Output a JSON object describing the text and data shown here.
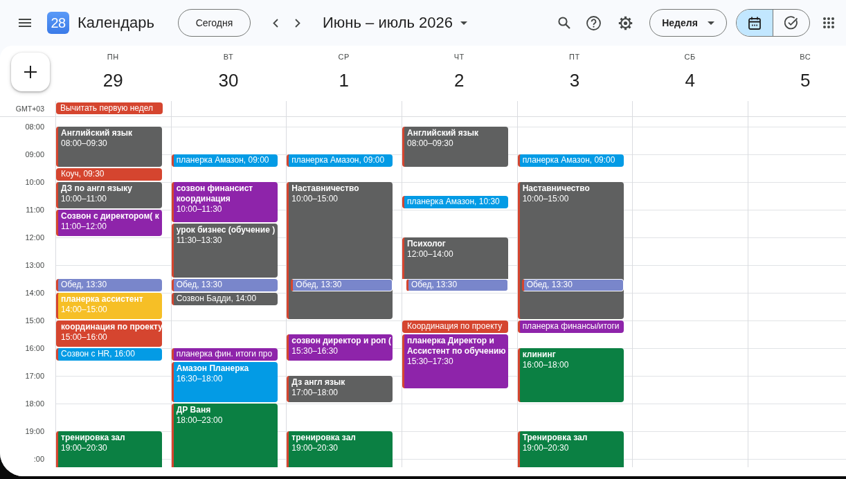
{
  "header": {
    "app_name": "Календарь",
    "logo_day": "28",
    "today_button": "Сегодня",
    "period_title": "Июнь – июль 2026",
    "view_button": "Неделя",
    "mode_toggle": [
      {
        "kind": "calendar",
        "selected": true
      },
      {
        "kind": "tasks",
        "selected": false
      }
    ]
  },
  "timezone": "GMT+03",
  "days": [
    {
      "weekday": "ПН",
      "date": "29",
      "all_day": [
        {
          "title": "Вычитать первую недел",
          "color": "#d5452f"
        }
      ]
    },
    {
      "weekday": "ВТ",
      "date": "30"
    },
    {
      "weekday": "СР",
      "date": "1"
    },
    {
      "weekday": "ЧТ",
      "date": "2"
    },
    {
      "weekday": "ПТ",
      "date": "3"
    },
    {
      "weekday": "СБ",
      "date": "4"
    },
    {
      "weekday": "ВС",
      "date": "5"
    }
  ],
  "rows": [
    {
      "label": "08:00",
      "cells": [
        {
          "events": [
            {
              "title": "Английский язык",
              "time": "08:00–09:30",
              "color": "#5f6060"
            }
          ]
        },
        {},
        {},
        {
          "events": [
            {
              "title": "Английский язык",
              "time": "08:00–09:30",
              "color": "#5f6060"
            }
          ]
        }
      ]
    },
    {
      "label": "09:00",
      "cells": [
        {
          "events": [
            {
              "title": "Коуч, 09:30",
              "color": "#d5452f"
            }
          ]
        },
        {
          "events": [
            {
              "title": "планерка Амазон, 09:00",
              "color": "#039be5"
            }
          ]
        },
        {
          "events": [
            {
              "title": "планерка Амазон, 09:00",
              "color": "#039be5"
            }
          ]
        },
        {},
        {
          "events": [
            {
              "title": "планерка Амазон, 09:00",
              "color": "#039be5"
            }
          ]
        }
      ]
    },
    {
      "label": "10:00",
      "cells": [
        {
          "events": [
            {
              "title": "ДЗ по англ языку",
              "time": "10:00–11:00",
              "color": "#5f6060"
            }
          ]
        },
        {
          "events": [
            {
              "title": "созвон финансист координация",
              "time": "10:00–11:30",
              "color": "#8e24aa"
            }
          ]
        },
        {
          "events": [
            {
              "title": "Наставничество",
              "time": "10:00–15:00",
              "color": "#5f6060"
            }
          ]
        },
        {
          "events": [
            {
              "title": "планерка Амазон, 10:30",
              "color": "#039be5"
            }
          ]
        },
        {
          "events": [
            {
              "title": "Наставничество",
              "time": "10:00–15:00",
              "color": "#5f6060"
            }
          ]
        }
      ]
    },
    {
      "label": "11:00",
      "cells": [
        {
          "events": [
            {
              "title": "Созвон с директором( к",
              "time": "11:00–12:00",
              "color": "#8e24aa"
            }
          ]
        },
        {
          "events": [
            {
              "title": "урок бизнес (обучение )",
              "time": "11:30–13:30",
              "color": "#5f6060"
            }
          ]
        }
      ]
    },
    {
      "label": "12:00",
      "cells": [
        {},
        {},
        {},
        {
          "events": [
            {
              "title": "Психолог",
              "time": "12:00–14:00",
              "color": "#5f6060"
            }
          ]
        }
      ]
    },
    {
      "label": "13:00",
      "cells": [
        {
          "events": [
            {
              "title": "Обед, 13:30",
              "color": "#7986cb"
            }
          ]
        },
        {
          "events": [
            {
              "title": "Обед, 13:30",
              "color": "#7986cb"
            }
          ]
        },
        {
          "events": [
            {
              "title": "Обед, 13:30",
              "color": "#7986cb"
            }
          ]
        },
        {
          "events": [
            {
              "title": "Обед, 13:30",
              "color": "#7986cb"
            }
          ]
        },
        {
          "events": [
            {
              "title": "Обед, 13:30",
              "color": "#7986cb"
            }
          ]
        }
      ]
    },
    {
      "label": "14:00",
      "cells": [
        {
          "events": [
            {
              "title": "планерка ассистент",
              "time": "14:00–15:00",
              "color": "#f6bf26"
            }
          ]
        },
        {
          "events": [
            {
              "title": "Созвон Бадди, 14:00",
              "color": "#5f6060"
            }
          ]
        }
      ]
    },
    {
      "label": "15:00",
      "cells": [
        {
          "events": [
            {
              "title": "координация по проекту",
              "time": "15:00–16:00",
              "color": "#d5452f"
            }
          ]
        },
        {},
        {
          "events": [
            {
              "title": "созвон директор и роп (",
              "time": "15:30–16:30",
              "color": "#8e24aa"
            }
          ]
        },
        {
          "events": [
            {
              "title": "Координация по проекту",
              "color": "#d5452f"
            },
            {
              "title": "планерка Директор и Ассистент по обучению",
              "time": "15:30–17:30",
              "color": "#8e24aa"
            }
          ]
        },
        {
          "events": [
            {
              "title": "планерка финансы/итоги",
              "color": "#8e24aa"
            }
          ]
        }
      ]
    },
    {
      "label": "16:00",
      "cells": [
        {
          "events": [
            {
              "title": "Созвон с HR, 16:00",
              "color": "#039be5"
            }
          ]
        },
        {
          "events": [
            {
              "title": "планерка фин. итоги про",
              "color": "#8e24aa"
            },
            {
              "title": "Амазон Планерка",
              "time": "16:30–18:00",
              "color": "#039be5"
            }
          ]
        },
        {},
        {},
        {
          "events": [
            {
              "title": "клининг",
              "time": "16:00–18:00",
              "color": "#0b8043"
            }
          ]
        }
      ]
    },
    {
      "label": "17:00",
      "cells": [
        {},
        {},
        {
          "events": [
            {
              "title": "Дз англ язык",
              "time": "17:00–18:00",
              "color": "#5f6060"
            }
          ]
        }
      ]
    },
    {
      "label": "18:00",
      "cells": [
        {},
        {
          "events": [
            {
              "title": "ДР Ваня",
              "time": "18:00–23:00",
              "color": "#0b8043"
            }
          ]
        }
      ]
    },
    {
      "label": "19:00",
      "cells": [
        {
          "events": [
            {
              "title": "тренировка зал",
              "time": "19:00–20:30",
              "color": "#0b8043"
            }
          ]
        },
        {},
        {
          "events": [
            {
              "title": "тренировка зал",
              "time": "19:00–20:30",
              "color": "#0b8043"
            }
          ]
        },
        {},
        {
          "events": [
            {
              "title": "Тренировка зал",
              "time": "19:00–20:30",
              "color": "#0b8043"
            }
          ]
        }
      ]
    },
    {
      "label": ":00"
    }
  ]
}
